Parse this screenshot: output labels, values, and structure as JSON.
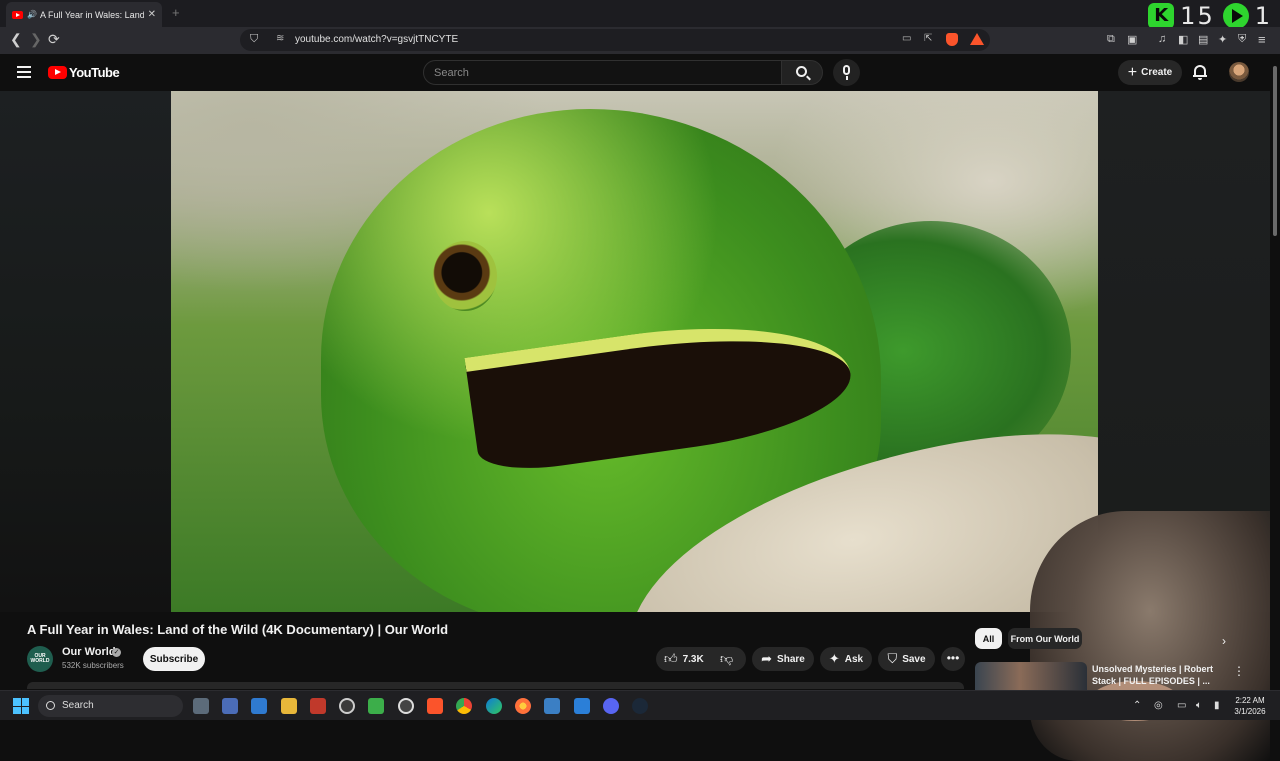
{
  "browser": {
    "tab": {
      "title": "A Full Year in Wales: Land of the Wild (4K Documentary) | Our World",
      "close": "✕"
    },
    "new_tab": "+",
    "url": "youtube.com/watch?v=gsvjtTNCYTE",
    "counter": {
      "k_label": "K",
      "k_count": "15",
      "play_count": "1"
    }
  },
  "masthead": {
    "logo_text": "YouTube",
    "search_placeholder": "Search",
    "create_label": "Create"
  },
  "video": {
    "title": "A Full Year in Wales: Land of the Wild (4K Documentary) | Our World"
  },
  "channel": {
    "avatar_text": "OUR WORLD",
    "name": "Our World",
    "subscribers": "532K subscribers",
    "subscribe_label": "Subscribe"
  },
  "actions": {
    "likes": "7.3K",
    "share": "Share",
    "ask": "Ask",
    "save": "Save"
  },
  "sidebar": {
    "chips": [
      "All",
      "From Our World"
    ],
    "recommendations": [
      {
        "title": "Unsolved Mysteries | Robert Stack | FULL EPISODES | ..."
      }
    ]
  },
  "taskbar": {
    "search_label": "Search",
    "time": "2:22 AM",
    "date": "3/1/2026"
  },
  "colors": {
    "yt_red": "#ff0000",
    "bg": "#0f0f0f",
    "counter_green": "#2ed52e",
    "brave_orange": "#fb542b",
    "windows_blue": "#4cc2ff"
  }
}
